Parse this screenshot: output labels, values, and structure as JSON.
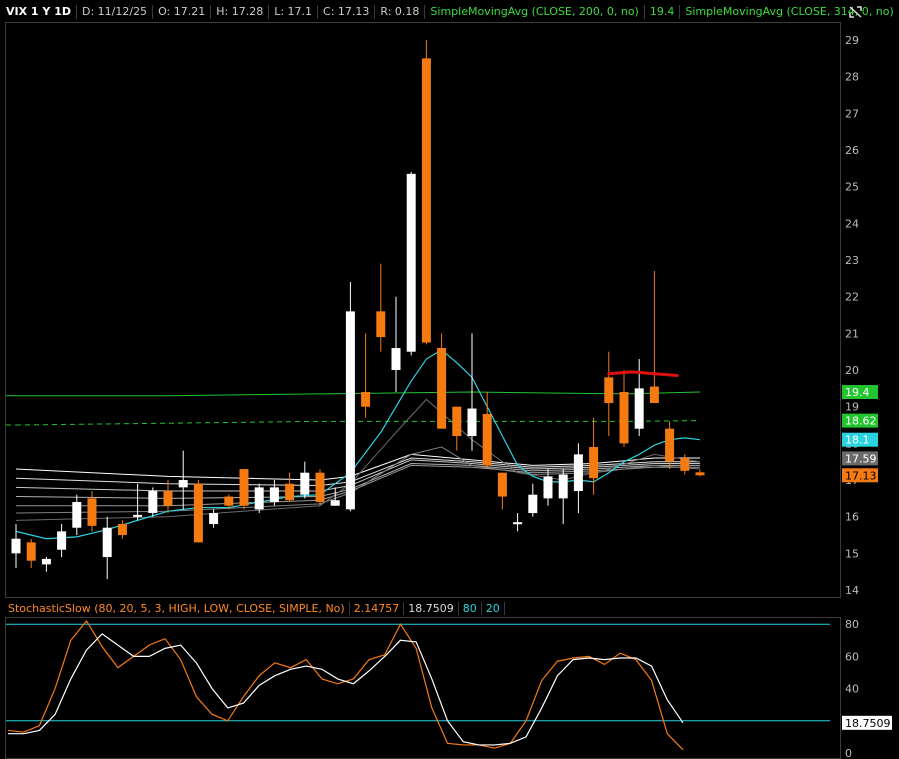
{
  "header": {
    "symbol": "VIX 1 Y 1D",
    "date": "D: 11/12/25",
    "open": "O: 17.21",
    "high": "H: 17.28",
    "low": "L: 17.1",
    "close": "C: 17.13",
    "range": "R: 0.18",
    "sma1_label": "SimpleMovingAvg (CLOSE, 200, 0, no)",
    "sma1_value": "19.4",
    "sma2_label": "SimpleMovingAvg (CLOSE, 314, 0, no)",
    "more": "..."
  },
  "indicator": {
    "label": "StochasticSlow (80, 20, 5, 3, HIGH, LOW, CLOSE, SIMPLE, No)",
    "value1": "2.14757",
    "value2": "18.7509",
    "level_high": "80",
    "level_low": "20"
  },
  "colors": {
    "up": "#ffffff",
    "down": "#f57a10",
    "sma200": "#22c52e",
    "sma314": "#22c52e",
    "ema_fast": "#29d3e0",
    "slowk": "#f57a10",
    "slowd": "#ffffff",
    "annotation": "#e01010"
  },
  "icons": {
    "toolbar": "crosshair-tool-icon"
  },
  "chart_data": [
    {
      "type": "candlestick",
      "yticks": [
        14,
        15,
        16,
        17,
        18,
        19,
        20,
        21,
        22,
        23,
        24,
        25,
        26,
        27,
        28,
        29
      ],
      "ylim": [
        14,
        29.3
      ],
      "price_badges": [
        {
          "text": "19.4",
          "value": 19.4,
          "color": "#22c52e"
        },
        {
          "text": "18.62",
          "value": 18.62,
          "color": "#22c52e"
        },
        {
          "text": "18.1",
          "value": 18.1,
          "color": "#29d3e0"
        },
        {
          "text": "17.59",
          "value": 17.59,
          "color": "#6a6a6a"
        },
        {
          "text": "17.13",
          "value": 17.13,
          "color": "#f57a10"
        }
      ],
      "candles": [
        {
          "o": 15.0,
          "h": 15.8,
          "l": 14.6,
          "c": 15.4
        },
        {
          "o": 15.3,
          "h": 15.4,
          "l": 14.6,
          "c": 14.8
        },
        {
          "o": 14.7,
          "h": 14.9,
          "l": 14.5,
          "c": 14.85
        },
        {
          "o": 15.1,
          "h": 15.8,
          "l": 14.9,
          "c": 15.6
        },
        {
          "o": 15.7,
          "h": 16.6,
          "l": 15.5,
          "c": 16.4
        },
        {
          "o": 16.5,
          "h": 16.7,
          "l": 15.6,
          "c": 15.75
        },
        {
          "o": 14.9,
          "h": 16.0,
          "l": 14.3,
          "c": 15.7
        },
        {
          "o": 15.8,
          "h": 15.9,
          "l": 15.4,
          "c": 15.5
        },
        {
          "o": 16.0,
          "h": 16.9,
          "l": 15.9,
          "c": 16.05
        },
        {
          "o": 16.1,
          "h": 16.8,
          "l": 16.0,
          "c": 16.7
        },
        {
          "o": 16.7,
          "h": 17.0,
          "l": 16.1,
          "c": 16.3
        },
        {
          "o": 16.8,
          "h": 17.8,
          "l": 16.2,
          "c": 17.0
        },
        {
          "o": 16.9,
          "h": 17.0,
          "l": 15.3,
          "c": 15.3
        },
        {
          "o": 15.8,
          "h": 16.2,
          "l": 15.7,
          "c": 16.1
        },
        {
          "o": 16.55,
          "h": 16.6,
          "l": 16.2,
          "c": 16.3
        },
        {
          "o": 17.3,
          "h": 17.3,
          "l": 16.2,
          "c": 16.3
        },
        {
          "o": 16.2,
          "h": 16.9,
          "l": 16.1,
          "c": 16.8
        },
        {
          "o": 16.4,
          "h": 17.0,
          "l": 16.3,
          "c": 16.8
        },
        {
          "o": 16.9,
          "h": 17.2,
          "l": 16.4,
          "c": 16.45
        },
        {
          "o": 16.6,
          "h": 17.5,
          "l": 16.5,
          "c": 17.2
        },
        {
          "o": 17.2,
          "h": 17.3,
          "l": 16.3,
          "c": 16.4
        },
        {
          "o": 16.3,
          "h": 16.8,
          "l": 16.3,
          "c": 16.45
        },
        {
          "o": 16.2,
          "h": 22.4,
          "l": 16.15,
          "c": 21.6
        },
        {
          "o": 19.4,
          "h": 21.0,
          "l": 18.7,
          "c": 19.0
        },
        {
          "o": 21.6,
          "h": 22.9,
          "l": 20.5,
          "c": 20.9
        },
        {
          "o": 20.0,
          "h": 22.0,
          "l": 19.4,
          "c": 20.6
        },
        {
          "o": 20.5,
          "h": 25.4,
          "l": 20.4,
          "c": 25.35
        },
        {
          "o": 28.5,
          "h": 29.0,
          "l": 20.7,
          "c": 20.75
        },
        {
          "o": 20.6,
          "h": 21.0,
          "l": 18.4,
          "c": 18.4
        },
        {
          "o": 19.0,
          "h": 19.0,
          "l": 17.8,
          "c": 18.2
        },
        {
          "o": 18.2,
          "h": 21.0,
          "l": 17.8,
          "c": 18.95
        },
        {
          "o": 18.8,
          "h": 19.4,
          "l": 17.3,
          "c": 17.4
        },
        {
          "o": 17.2,
          "h": 17.2,
          "l": 16.2,
          "c": 16.55
        },
        {
          "o": 15.8,
          "h": 16.1,
          "l": 15.6,
          "c": 15.85
        },
        {
          "o": 16.1,
          "h": 16.9,
          "l": 16.0,
          "c": 16.6
        },
        {
          "o": 16.5,
          "h": 17.3,
          "l": 16.3,
          "c": 17.1
        },
        {
          "o": 16.5,
          "h": 17.3,
          "l": 15.8,
          "c": 17.15
        },
        {
          "o": 16.7,
          "h": 18.0,
          "l": 16.1,
          "c": 17.7
        },
        {
          "o": 17.9,
          "h": 18.7,
          "l": 16.6,
          "c": 17.05
        },
        {
          "o": 19.8,
          "h": 20.5,
          "l": 18.2,
          "c": 19.1
        },
        {
          "o": 19.4,
          "h": 20.0,
          "l": 17.9,
          "c": 18.0
        },
        {
          "o": 18.4,
          "h": 20.3,
          "l": 18.2,
          "c": 19.5
        },
        {
          "o": 19.55,
          "h": 22.7,
          "l": 19.1,
          "c": 19.1
        },
        {
          "o": 18.4,
          "h": 18.6,
          "l": 17.3,
          "c": 17.5
        },
        {
          "o": 17.6,
          "h": 17.7,
          "l": 17.15,
          "c": 17.25
        },
        {
          "o": 17.21,
          "h": 17.28,
          "l": 17.1,
          "c": 17.13
        }
      ],
      "sma200_solid": [
        [
          0,
          19.3
        ],
        [
          10,
          19.3
        ],
        [
          20,
          19.35
        ],
        [
          30,
          19.4
        ],
        [
          40,
          19.35
        ],
        [
          45,
          19.4
        ]
      ],
      "sma314_dashed": [
        [
          0,
          18.5
        ],
        [
          10,
          18.55
        ],
        [
          20,
          18.6
        ],
        [
          30,
          18.6
        ],
        [
          40,
          18.6
        ],
        [
          45,
          18.62
        ]
      ],
      "ema_fast": [
        [
          0,
          15.6
        ],
        [
          2,
          15.4
        ],
        [
          4,
          15.45
        ],
        [
          6,
          15.65
        ],
        [
          8,
          15.9
        ],
        [
          10,
          16.15
        ],
        [
          12,
          16.25
        ],
        [
          14,
          16.25
        ],
        [
          16,
          16.4
        ],
        [
          18,
          16.55
        ],
        [
          20,
          16.6
        ],
        [
          22,
          17.2
        ],
        [
          24,
          18.3
        ],
        [
          26,
          19.7
        ],
        [
          27,
          20.3
        ],
        [
          28,
          20.55
        ],
        [
          29,
          20.2
        ],
        [
          30,
          19.8
        ],
        [
          31,
          19.0
        ],
        [
          32,
          18.2
        ],
        [
          33,
          17.4
        ],
        [
          34,
          17.1
        ],
        [
          35,
          16.95
        ],
        [
          36,
          16.95
        ],
        [
          37,
          17.0
        ],
        [
          38,
          16.95
        ],
        [
          39,
          17.2
        ],
        [
          40,
          17.5
        ],
        [
          41,
          17.7
        ],
        [
          42,
          17.95
        ],
        [
          43,
          18.1
        ],
        [
          44,
          18.15
        ],
        [
          45,
          18.1
        ]
      ],
      "ma_bundle": [
        [
          [
            0,
            17.3
          ],
          [
            10,
            17.1
          ],
          [
            20,
            17.0
          ],
          [
            22,
            17.1
          ],
          [
            26,
            17.7
          ],
          [
            30,
            17.55
          ],
          [
            34,
            17.4
          ],
          [
            38,
            17.45
          ],
          [
            42,
            17.6
          ],
          [
            45,
            17.6
          ]
        ],
        [
          [
            0,
            17.05
          ],
          [
            10,
            16.9
          ],
          [
            20,
            16.85
          ],
          [
            22,
            16.95
          ],
          [
            26,
            17.6
          ],
          [
            30,
            17.5
          ],
          [
            34,
            17.35
          ],
          [
            38,
            17.4
          ],
          [
            42,
            17.5
          ],
          [
            45,
            17.5
          ]
        ],
        [
          [
            0,
            16.8
          ],
          [
            10,
            16.7
          ],
          [
            20,
            16.7
          ],
          [
            22,
            16.85
          ],
          [
            26,
            17.55
          ],
          [
            30,
            17.45
          ],
          [
            34,
            17.3
          ],
          [
            38,
            17.35
          ],
          [
            42,
            17.45
          ],
          [
            45,
            17.45
          ]
        ],
        [
          [
            0,
            16.55
          ],
          [
            10,
            16.5
          ],
          [
            20,
            16.55
          ],
          [
            22,
            16.75
          ],
          [
            26,
            17.45
          ],
          [
            30,
            17.4
          ],
          [
            34,
            17.25
          ],
          [
            38,
            17.3
          ],
          [
            42,
            17.4
          ],
          [
            45,
            17.4
          ]
        ],
        [
          [
            0,
            16.3
          ],
          [
            10,
            16.3
          ],
          [
            20,
            16.45
          ],
          [
            22,
            16.7
          ],
          [
            26,
            17.4
          ],
          [
            30,
            17.35
          ],
          [
            34,
            17.2
          ],
          [
            38,
            17.25
          ],
          [
            42,
            17.35
          ],
          [
            45,
            17.35
          ]
        ],
        [
          [
            0,
            16.1
          ],
          [
            10,
            16.15
          ],
          [
            20,
            16.35
          ],
          [
            22,
            16.65
          ],
          [
            26,
            17.7
          ],
          [
            28,
            17.9
          ],
          [
            30,
            17.4
          ],
          [
            34,
            17.15
          ],
          [
            38,
            17.2
          ],
          [
            42,
            17.4
          ],
          [
            45,
            17.3
          ]
        ],
        [
          [
            0,
            15.9
          ],
          [
            10,
            16.0
          ],
          [
            20,
            16.3
          ],
          [
            22,
            16.9
          ],
          [
            25,
            18.3
          ],
          [
            27,
            19.2
          ],
          [
            30,
            18.1
          ],
          [
            33,
            17.2
          ],
          [
            36,
            17.0
          ],
          [
            39,
            17.3
          ],
          [
            42,
            17.7
          ],
          [
            45,
            17.5
          ]
        ]
      ],
      "annotation_curve": [
        [
          39,
          19.9
        ],
        [
          40.5,
          19.95
        ],
        [
          42,
          19.9
        ],
        [
          43.5,
          19.85
        ]
      ]
    },
    {
      "type": "line",
      "name": "StochasticSlow",
      "yticks": [
        0,
        20,
        40,
        60,
        80
      ],
      "ylim": [
        0,
        85
      ],
      "levels": [
        80,
        20
      ],
      "value_badge": {
        "text": "18.7509",
        "value": 18.7509
      },
      "series": [
        {
          "color": "#f57a10",
          "values": [
            14,
            13,
            17,
            40,
            70,
            82,
            66,
            53,
            60,
            67,
            71,
            58,
            35,
            24,
            20,
            35,
            48,
            56,
            53,
            58,
            46,
            43,
            46,
            58,
            61,
            80,
            65,
            28,
            6,
            5,
            5,
            3,
            6,
            20,
            45,
            57,
            59,
            60,
            55,
            62,
            58,
            45,
            12,
            2
          ]
        },
        {
          "color": "#ffffff",
          "values": [
            12,
            12,
            14,
            24,
            46,
            64,
            74,
            67,
            60,
            60,
            65,
            67,
            56,
            40,
            28,
            31,
            42,
            48,
            52,
            54,
            52,
            46,
            43,
            51,
            60,
            70,
            69,
            46,
            20,
            7,
            5,
            5,
            6,
            10,
            28,
            48,
            58,
            59,
            58,
            59,
            59,
            54,
            33,
            18.75
          ]
        }
      ]
    }
  ]
}
